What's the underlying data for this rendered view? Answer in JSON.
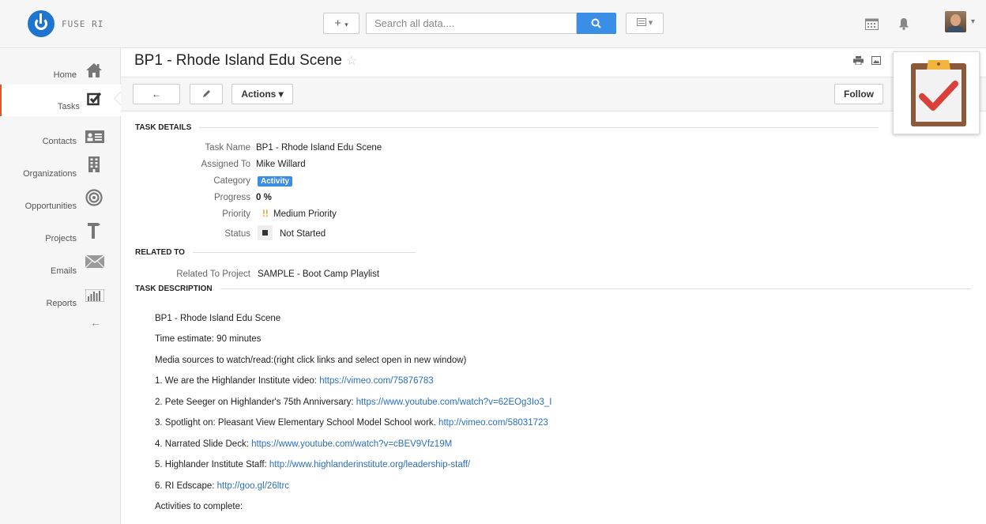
{
  "brand": {
    "name": "FUSE RI"
  },
  "search": {
    "placeholder": "Search all data....",
    "add_symbol": "+",
    "add_caret": "▾",
    "view_caret": "▾"
  },
  "sidebar": {
    "items": [
      {
        "label": "Home",
        "icon": "home-icon"
      },
      {
        "label": "Tasks",
        "icon": "checkbox-icon"
      },
      {
        "label": "Contacts",
        "icon": "contact-card-icon"
      },
      {
        "label": "Organizations",
        "icon": "building-icon"
      },
      {
        "label": "Opportunities",
        "icon": "target-icon"
      },
      {
        "label": "Projects",
        "icon": "hammer-icon"
      },
      {
        "label": "Emails",
        "icon": "envelope-icon"
      },
      {
        "label": "Reports",
        "icon": "bar-chart-icon"
      }
    ],
    "active": "Tasks"
  },
  "page": {
    "title": "BP1 - Rhode Island Edu Scene",
    "star": "☆"
  },
  "toolbar": {
    "back": "←",
    "actions": "Actions ▾",
    "follow": "Follow"
  },
  "task_details": {
    "header": "TASK DETAILS",
    "fields": [
      {
        "label": "Task Name",
        "value": "BP1 - Rhode Island Edu Scene"
      },
      {
        "label": "Assigned To",
        "value": "Mike Willard"
      },
      {
        "label": "Category",
        "value": "Activity"
      },
      {
        "label": "Progress",
        "value": "0 %"
      },
      {
        "label": "Priority",
        "value": "Medium Priority",
        "marker": "!!"
      },
      {
        "label": "Status",
        "value": "Not Started"
      }
    ]
  },
  "related": {
    "header": "RELATED TO",
    "label": "Related To Project",
    "value": "SAMPLE - Boot Camp Playlist"
  },
  "description": {
    "header": "TASK DESCRIPTION",
    "lines": [
      {
        "text": "BP1 - Rhode Island Edu Scene",
        "link": ""
      },
      {
        "text": "Time estimate: 90 minutes",
        "link": ""
      },
      {
        "text": "Media sources to watch/read:(right click links and select open in new window)",
        "link": ""
      },
      {
        "text": "1. We are the Highlander Institute video: ",
        "link": "https://vimeo.com/75876783"
      },
      {
        "text": "2. Pete Seeger on Highlander's 75th Anniversary: ",
        "link": "https://www.youtube.com/watch?v=62EOg3Io3_I"
      },
      {
        "text": "3. Spotlight on: Pleasant View Elementary School Model School work. ",
        "link": "http://vimeo.com/58031723"
      },
      {
        "text": "4. Narrated Slide Deck: ",
        "link": "https://www.youtube.com/watch?v=cBEV9Vfz19M"
      },
      {
        "text": "5. Highlander Institute Staff: ",
        "link": "http://www.highlanderinstitute.org/leadership-staff/"
      },
      {
        "text": "6. RI Edscape: ",
        "link": "http://goo.gl/26ltrc"
      },
      {
        "text": "Activities to complete:",
        "link": ""
      }
    ]
  },
  "colors": {
    "accent": "#3a8ee6",
    "active_border": "#e5532a",
    "link": "#2a6ebb",
    "check": "#d9403a"
  }
}
